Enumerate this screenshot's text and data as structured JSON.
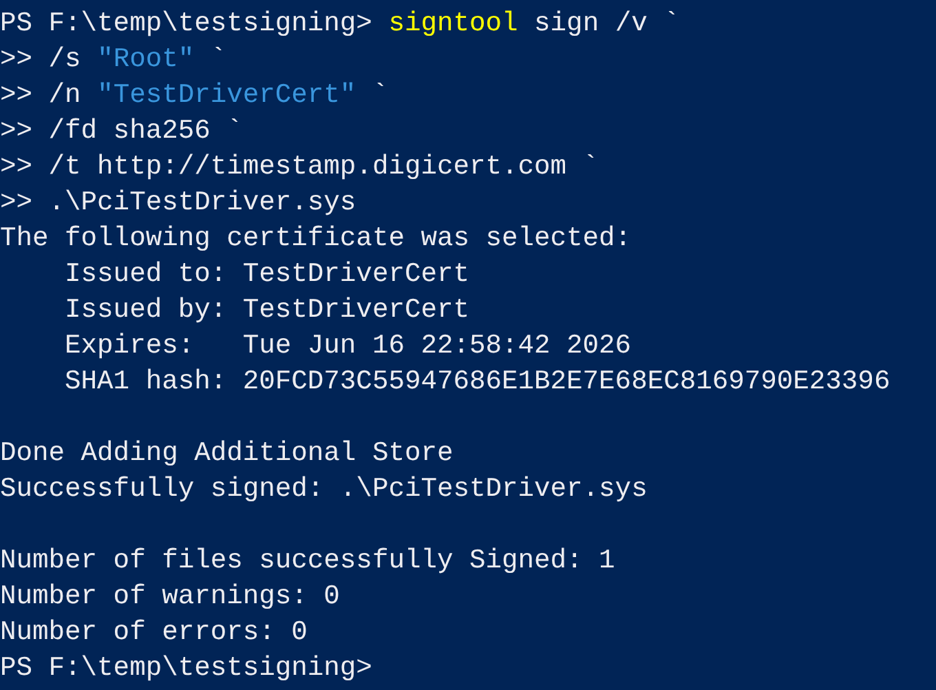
{
  "terminal": {
    "lines": [
      {
        "kind": "text",
        "segments": [
          {
            "kind": "plain",
            "text": "PS F:\\temp\\testsigning> "
          },
          {
            "kind": "command",
            "text": "signtool"
          },
          {
            "kind": "plain",
            "text": " sign /v `"
          }
        ]
      },
      {
        "kind": "text",
        "segments": [
          {
            "kind": "plain",
            "text": ">> /s "
          },
          {
            "kind": "string",
            "text": "\"Root\""
          },
          {
            "kind": "plain",
            "text": " `"
          }
        ]
      },
      {
        "kind": "text",
        "segments": [
          {
            "kind": "plain",
            "text": ">> /n "
          },
          {
            "kind": "string",
            "text": "\"TestDriverCert\""
          },
          {
            "kind": "plain",
            "text": " `"
          }
        ]
      },
      {
        "kind": "text",
        "segments": [
          {
            "kind": "plain",
            "text": ">> /fd sha256 `"
          }
        ]
      },
      {
        "kind": "text",
        "segments": [
          {
            "kind": "plain",
            "text": ">> /t http://timestamp.digicert.com `"
          }
        ]
      },
      {
        "kind": "text",
        "segments": [
          {
            "kind": "plain",
            "text": ">> .\\PciTestDriver.sys"
          }
        ]
      },
      {
        "kind": "text",
        "segments": [
          {
            "kind": "plain",
            "text": "The following certificate was selected:"
          }
        ]
      },
      {
        "kind": "text",
        "segments": [
          {
            "kind": "plain",
            "text": "    Issued to: TestDriverCert"
          }
        ]
      },
      {
        "kind": "text",
        "segments": [
          {
            "kind": "plain",
            "text": "    Issued by: TestDriverCert"
          }
        ]
      },
      {
        "kind": "text",
        "segments": [
          {
            "kind": "plain",
            "text": "    Expires:   Tue Jun 16 22:58:42 2026"
          }
        ]
      },
      {
        "kind": "text",
        "segments": [
          {
            "kind": "plain",
            "text": "    SHA1 hash: 20FCD73C55947686E1B2E7E68EC8169790E23396"
          }
        ]
      },
      {
        "kind": "blank"
      },
      {
        "kind": "text",
        "segments": [
          {
            "kind": "plain",
            "text": "Done Adding Additional Store"
          }
        ]
      },
      {
        "kind": "text",
        "segments": [
          {
            "kind": "plain",
            "text": "Successfully signed: .\\PciTestDriver.sys"
          }
        ]
      },
      {
        "kind": "blank"
      },
      {
        "kind": "text",
        "segments": [
          {
            "kind": "plain",
            "text": "Number of files successfully Signed: 1"
          }
        ]
      },
      {
        "kind": "text",
        "segments": [
          {
            "kind": "plain",
            "text": "Number of warnings: 0"
          }
        ]
      },
      {
        "kind": "text",
        "segments": [
          {
            "kind": "plain",
            "text": "Number of errors: 0"
          }
        ]
      },
      {
        "kind": "text",
        "segments": [
          {
            "kind": "plain",
            "text": "PS F:\\temp\\testsigning>"
          }
        ]
      }
    ]
  }
}
